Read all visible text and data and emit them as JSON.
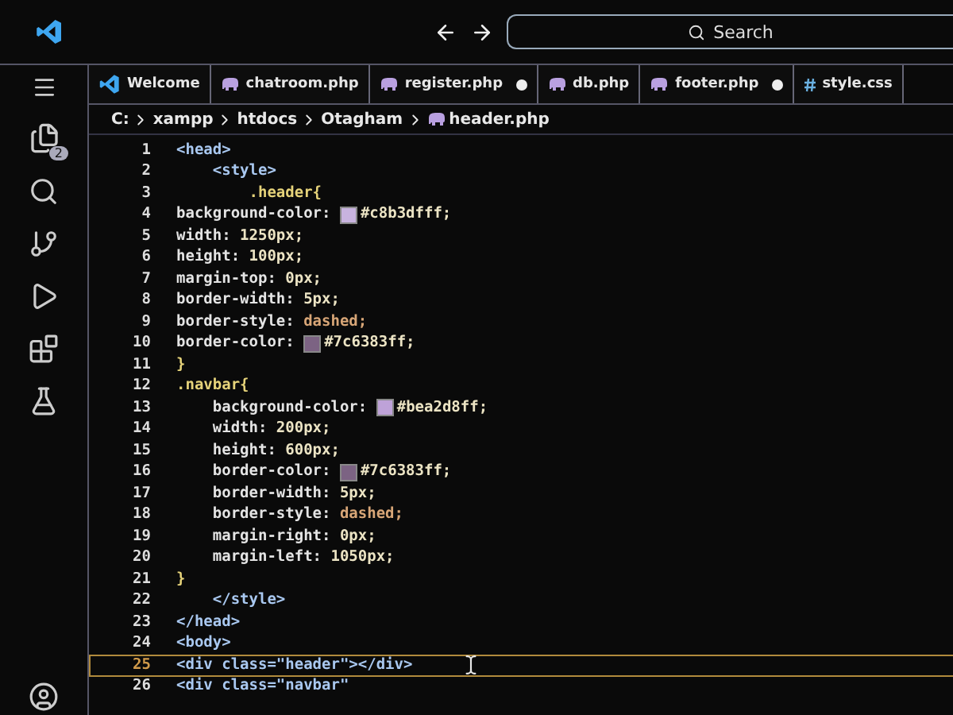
{
  "title_bar": {
    "search": {
      "placeholder": "Search"
    }
  },
  "activity_bar": {
    "explorer_badge": "2"
  },
  "tabs": [
    {
      "label": "Welcome",
      "kind": "welcome",
      "modified": false,
      "selected": false
    },
    {
      "label": "chatroom.php",
      "kind": "php",
      "modified": false,
      "selected": false
    },
    {
      "label": "register.php",
      "kind": "php",
      "modified": true,
      "selected": false
    },
    {
      "label": "db.php",
      "kind": "php",
      "modified": false,
      "selected": false
    },
    {
      "label": "footer.php",
      "kind": "php",
      "modified": true,
      "selected": false
    },
    {
      "label": "style.css",
      "kind": "css",
      "modified": false,
      "selected": false
    }
  ],
  "breadcrumb": [
    "C:",
    "xampp",
    "htdocs",
    "Otagham",
    "header.php"
  ],
  "editor": {
    "lines": [
      {
        "number": "1",
        "current": false,
        "tokens": [
          {
            "kind": "tag",
            "text": "<head>"
          }
        ]
      },
      {
        "number": "2",
        "current": false,
        "tokens": [
          {
            "kind": "tag",
            "text": "    <style>"
          }
        ]
      },
      {
        "number": "3",
        "current": false,
        "tokens": [
          {
            "kind": "selector",
            "text": "        .header{"
          }
        ]
      },
      {
        "number": "4",
        "current": false,
        "tokens": [
          {
            "kind": "prop",
            "text": "background-color: "
          },
          {
            "kind": "swatch",
            "color": "#c8b3df"
          },
          {
            "kind": "number",
            "text": "#c8b3dfff;"
          }
        ]
      },
      {
        "number": "5",
        "current": false,
        "tokens": [
          {
            "kind": "prop",
            "text": "width: "
          },
          {
            "kind": "number",
            "text": "1250px;"
          }
        ]
      },
      {
        "number": "6",
        "current": false,
        "tokens": [
          {
            "kind": "prop",
            "text": "height: "
          },
          {
            "kind": "number",
            "text": "100px;"
          }
        ]
      },
      {
        "number": "7",
        "current": false,
        "tokens": [
          {
            "kind": "prop",
            "text": "margin-top: "
          },
          {
            "kind": "number",
            "text": "0px;"
          }
        ]
      },
      {
        "number": "8",
        "current": false,
        "tokens": [
          {
            "kind": "prop",
            "text": "border-width: "
          },
          {
            "kind": "number",
            "text": "5px;"
          }
        ]
      },
      {
        "number": "9",
        "current": false,
        "tokens": [
          {
            "kind": "prop",
            "text": "border-style: "
          },
          {
            "kind": "value",
            "text": "dashed;"
          }
        ]
      },
      {
        "number": "10",
        "current": false,
        "tokens": [
          {
            "kind": "prop",
            "text": "border-color: "
          },
          {
            "kind": "swatch",
            "color": "#7c6383"
          },
          {
            "kind": "number",
            "text": "#7c6383ff;"
          }
        ]
      },
      {
        "number": "11",
        "current": false,
        "tokens": [
          {
            "kind": "selector",
            "text": "}"
          }
        ]
      },
      {
        "number": "12",
        "current": false,
        "tokens": [
          {
            "kind": "selector",
            "text": ".navbar{"
          }
        ]
      },
      {
        "number": "13",
        "current": false,
        "tokens": [
          {
            "kind": "prop",
            "text": "    background-color: "
          },
          {
            "kind": "swatch",
            "color": "#bea2d8"
          },
          {
            "kind": "number",
            "text": "#bea2d8ff;"
          }
        ]
      },
      {
        "number": "14",
        "current": false,
        "tokens": [
          {
            "kind": "prop",
            "text": "    width: "
          },
          {
            "kind": "number",
            "text": "200px;"
          }
        ]
      },
      {
        "number": "15",
        "current": false,
        "tokens": [
          {
            "kind": "prop",
            "text": "    height: "
          },
          {
            "kind": "number",
            "text": "600px;"
          }
        ]
      },
      {
        "number": "16",
        "current": false,
        "tokens": [
          {
            "kind": "prop",
            "text": "    border-color: "
          },
          {
            "kind": "swatch",
            "color": "#7c6383"
          },
          {
            "kind": "number",
            "text": "#7c6383ff;"
          }
        ]
      },
      {
        "number": "17",
        "current": false,
        "tokens": [
          {
            "kind": "prop",
            "text": "    border-width: "
          },
          {
            "kind": "number",
            "text": "5px;"
          }
        ]
      },
      {
        "number": "18",
        "current": false,
        "tokens": [
          {
            "kind": "prop",
            "text": "    border-style: "
          },
          {
            "kind": "value",
            "text": "dashed;"
          }
        ]
      },
      {
        "number": "19",
        "current": false,
        "tokens": [
          {
            "kind": "prop",
            "text": "    margin-right: "
          },
          {
            "kind": "number",
            "text": "0px;"
          }
        ]
      },
      {
        "number": "20",
        "current": false,
        "tokens": [
          {
            "kind": "prop",
            "text": "    margin-left: "
          },
          {
            "kind": "number",
            "text": "1050px;"
          }
        ]
      },
      {
        "number": "21",
        "current": false,
        "tokens": [
          {
            "kind": "selector",
            "text": "}"
          }
        ]
      },
      {
        "number": "22",
        "current": false,
        "tokens": [
          {
            "kind": "tag",
            "text": "    </style>"
          }
        ]
      },
      {
        "number": "23",
        "current": false,
        "tokens": [
          {
            "kind": "tag",
            "text": "</head>"
          }
        ]
      },
      {
        "number": "24",
        "current": false,
        "tokens": [
          {
            "kind": "tag",
            "text": "<body>"
          }
        ]
      },
      {
        "number": "25",
        "current": true,
        "tokens": [
          {
            "kind": "tag",
            "text": "<div class=\"header\"></div>"
          }
        ]
      },
      {
        "number": "26",
        "current": false,
        "tokens": [
          {
            "kind": "tag",
            "text": "<div class=\"navbar\""
          }
        ]
      }
    ]
  }
}
